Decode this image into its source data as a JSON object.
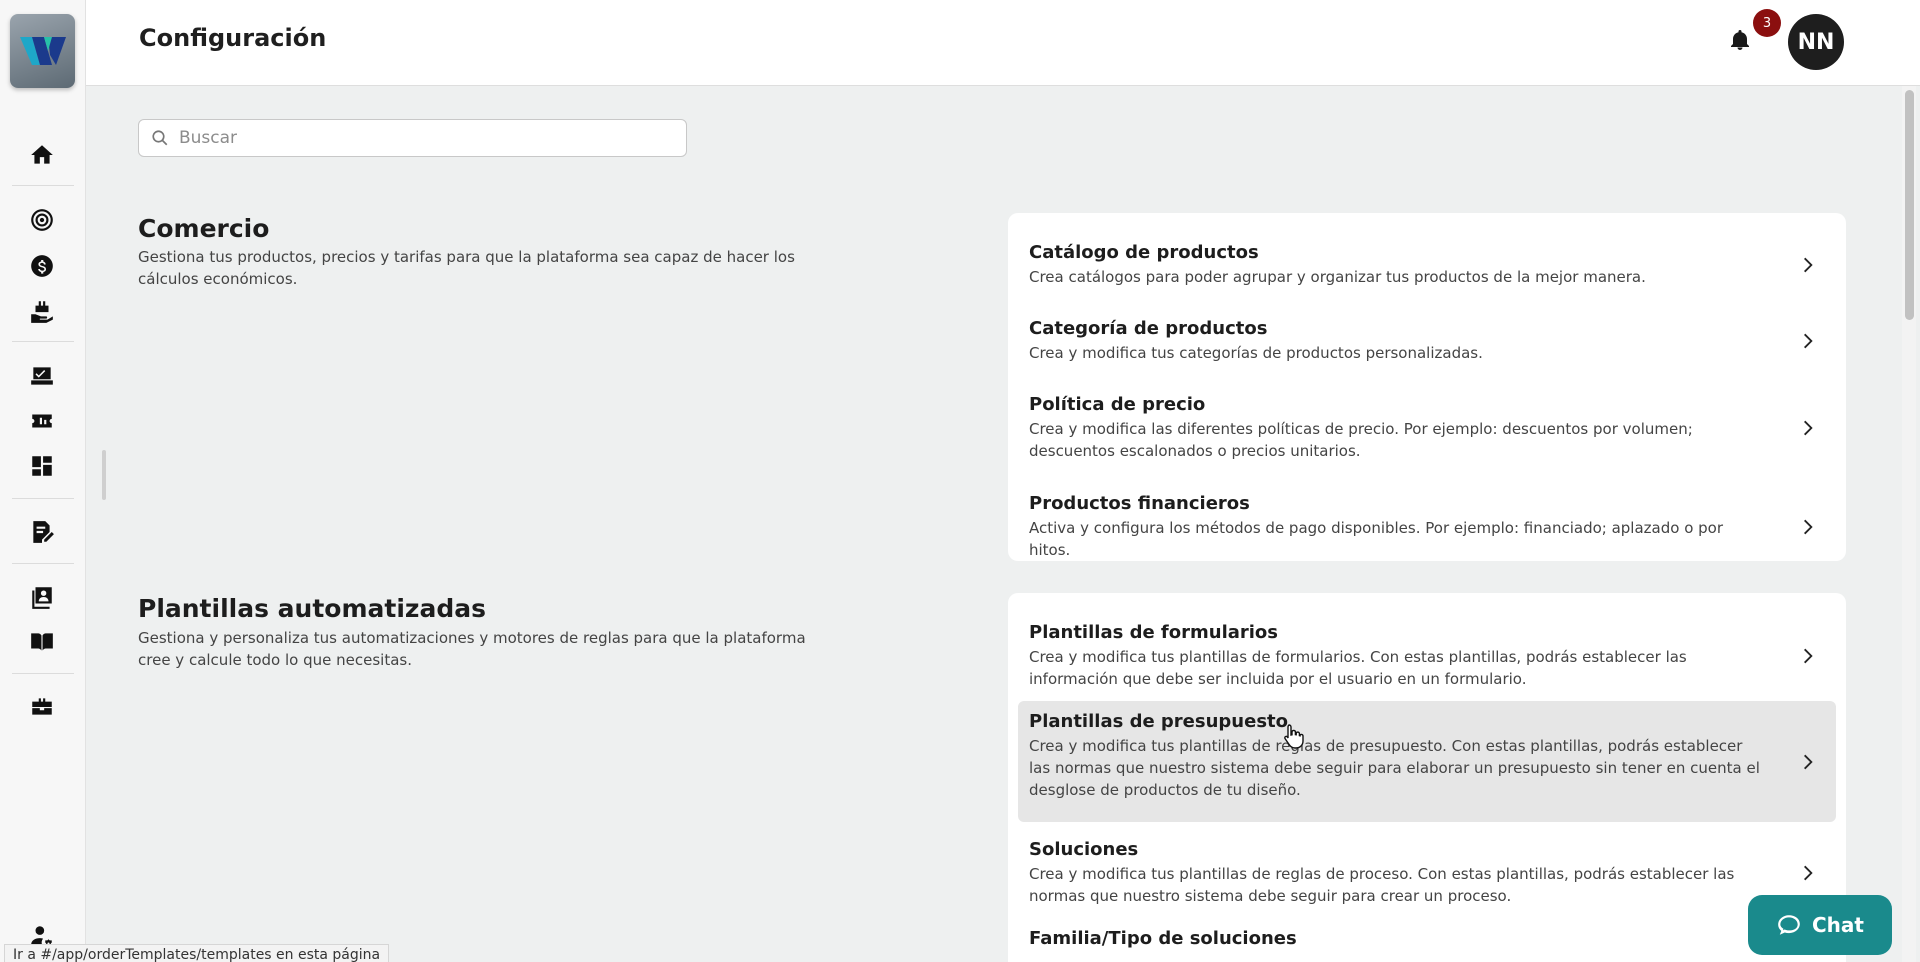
{
  "app": {
    "title": "Configuración"
  },
  "header": {
    "notification_count": "3",
    "avatar_initials": "NN"
  },
  "search": {
    "placeholder": "Buscar",
    "value": ""
  },
  "sidebar": {
    "items": [
      {
        "icon": "home-icon"
      },
      {
        "icon": "target-icon"
      },
      {
        "icon": "dollar-icon"
      },
      {
        "icon": "hand-box-icon"
      },
      {
        "icon": "task-check-icon"
      },
      {
        "icon": "ticket-icon"
      },
      {
        "icon": "dashboard-icon"
      },
      {
        "icon": "document-edit-icon"
      },
      {
        "icon": "contacts-book-icon"
      },
      {
        "icon": "open-book-icon"
      },
      {
        "icon": "toolbox-icon"
      },
      {
        "icon": "user-settings-icon"
      }
    ]
  },
  "sections": {
    "comercio": {
      "title": "Comercio",
      "description": "Gestiona tus productos, precios y tarifas para que la plataforma sea capaz de hacer los cálculos económicos.",
      "items": [
        {
          "title": "Catálogo de productos",
          "description": "Crea catálogos para poder agrupar y organizar tus productos de la mejor manera."
        },
        {
          "title": "Categoría de productos",
          "description": "Crea y modifica tus categorías de productos personalizadas."
        },
        {
          "title": "Política de precio",
          "description": "Crea y modifica las diferentes políticas de precio. Por ejemplo: descuentos por volumen; descuentos escalonados o precios unitarios."
        },
        {
          "title": "Productos financieros",
          "description": "Activa y configura los métodos de pago disponibles. Por ejemplo: financiado; aplazado o por hitos."
        }
      ]
    },
    "plantillas": {
      "title": "Plantillas automatizadas",
      "description": "Gestiona y personaliza tus automatizaciones y motores de reglas para que la plataforma cree y calcule todo lo que necesitas.",
      "items": [
        {
          "title": "Plantillas de formularios",
          "description": "Crea y modifica tus plantillas de formularios. Con estas plantillas, podrás establecer las información que debe ser incluida por el usuario en un formulario."
        },
        {
          "title": "Plantillas de presupuesto",
          "description": "Crea y modifica tus plantillas de reglas de presupuesto. Con estas plantillas, podrás establecer las normas que nuestro sistema debe seguir para elaborar un presupuesto sin tener en cuenta el desglose de productos de tu diseño."
        },
        {
          "title": "Soluciones",
          "description": "Crea y modifica tus plantillas de reglas de proceso. Con estas plantillas, podrás establecer las normas que nuestro sistema debe seguir para crear un proceso."
        },
        {
          "title": "Familia/Tipo de soluciones",
          "description": ""
        }
      ]
    }
  },
  "chat": {
    "label": "Chat"
  },
  "status_bar": {
    "text": "Ir a #/app/orderTemplates/templates en esta página"
  }
}
